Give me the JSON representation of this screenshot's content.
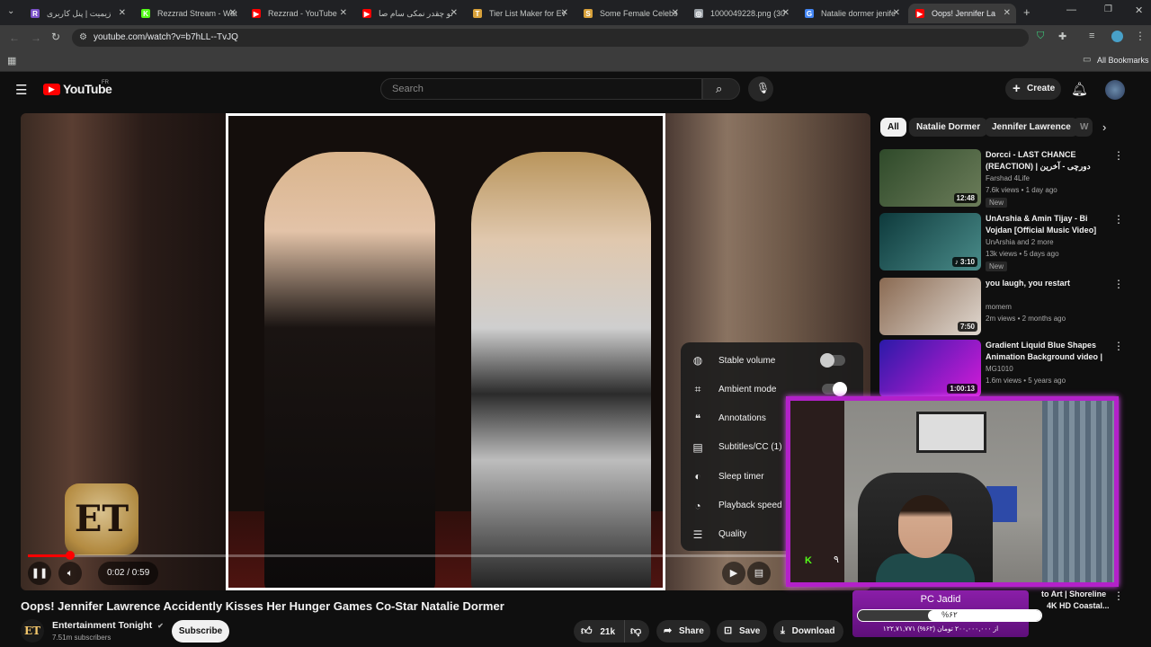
{
  "browser": {
    "tabs": [
      {
        "label": "زیمیت | پنل کاربری",
        "favicon": "R",
        "color": "#7b52c8"
      },
      {
        "label": "Rezzrad Stream - Wat",
        "favicon": "K",
        "color": "#53fc18"
      },
      {
        "label": "Rezzrad - YouTube",
        "favicon": "▶",
        "color": "#ff0000"
      },
      {
        "label": "تو چقدر نمکی سام صا",
        "favicon": "▶",
        "color": "#ff0000"
      },
      {
        "label": "Tier List Maker for Ev",
        "favicon": "T",
        "color": "#d8a13a"
      },
      {
        "label": "Some Female Celebs",
        "favicon": "S",
        "color": "#d8a13a"
      },
      {
        "label": "1000049228.png (30",
        "favicon": "◎",
        "color": "#9aa0a6"
      },
      {
        "label": "Natalie dormer jenife",
        "favicon": "G",
        "color": "#4285f4"
      },
      {
        "label": "Oops! Jennifer La",
        "favicon": "▶",
        "color": "#ff0000"
      }
    ],
    "url": "youtube.com/watch?v=b7hLL--TvJQ",
    "all_bookmarks": "All Bookmarks"
  },
  "youtube": {
    "logo_text": "YouTube",
    "region": "FR",
    "search_placeholder": "Search",
    "create_label": "Create"
  },
  "player": {
    "time": "0:02 / 0:59",
    "progress_fraction": 0.051,
    "logo_text": "ET",
    "settings_menu": [
      {
        "icon": "stable-volume-icon",
        "glyph": "◍",
        "label": "Stable volume",
        "toggle": false
      },
      {
        "icon": "ambient-mode-icon",
        "glyph": "⌗",
        "label": "Ambient mode",
        "toggle": true
      },
      {
        "icon": "annotations-icon",
        "glyph": "❝",
        "label": "Annotations"
      },
      {
        "icon": "subtitles-icon",
        "glyph": "▤",
        "label": "Subtitles/CC (1)"
      },
      {
        "icon": "sleep-timer-icon",
        "glyph": "◐",
        "label": "Sleep timer"
      },
      {
        "icon": "playback-speed-icon",
        "glyph": "◔",
        "label": "Playback speed"
      },
      {
        "icon": "quality-icon",
        "glyph": "☰",
        "label": "Quality"
      }
    ]
  },
  "chips": [
    "All",
    "Natalie Dormer",
    "Jennifer Lawrence",
    "W"
  ],
  "recommendations": [
    {
      "title": "Dorcci - LAST CHANCE (REACTION) | دورچی - آخرین فرصت",
      "channel": "Farshad 4Life",
      "meta": "7.6k views • 1 day ago",
      "badge": "New",
      "duration": "12:48",
      "thumb_a": "#2f4a2a",
      "thumb_b": "#6c7d5a"
    },
    {
      "title": "UnArshia & Amin Tijay - Bi Vojdan [Official Music Video]",
      "channel": "UnArshia and 2 more",
      "meta": "13k views • 5 days ago",
      "badge": "New",
      "duration": "♪ 3:10",
      "thumb_a": "#0e3a3c",
      "thumb_b": "#4a8c8a"
    },
    {
      "title": "you laugh, you restart",
      "channel": "momem",
      "meta": "2m views • 2 months ago",
      "badge": "",
      "duration": "7:50",
      "thumb_a": "#8a6a52",
      "thumb_b": "#e0d8d0"
    },
    {
      "title": "Gradient Liquid Blue Shapes Animation Background video | ...",
      "channel": "MG1010",
      "meta": "1.6m views • 5 years ago",
      "badge": "",
      "duration": "1:00:13",
      "thumb_a": "#2a1aa8",
      "thumb_b": "#d41bd8"
    }
  ],
  "partial_rec": {
    "title": "to Art | Shoreline",
    "subtitle": "4K HD Coastal..."
  },
  "webcam": {
    "panel_title": "PC Jadid",
    "percent_label": "%۶۲",
    "percent_value": 0.62,
    "amount_text": "۱۲۲,۷۱,۷۷۱ از ۲۰۰,۰۰۰,۰۰۰ تومان (۶۲%)",
    "kick_glyph": "K",
    "number_glyph": "۹"
  },
  "video": {
    "title": "Oops! Jennifer Lawrence Accidently Kisses Her Hunger Games Co-Star Natalie Dormer",
    "channel": "Entertainment Tonight",
    "channel_initials": "ET",
    "subscribers": "7.51m subscribers",
    "subscribe_label": "Subscribe",
    "likes": "21k",
    "share_label": "Share",
    "save_label": "Save",
    "download_label": "Download"
  }
}
